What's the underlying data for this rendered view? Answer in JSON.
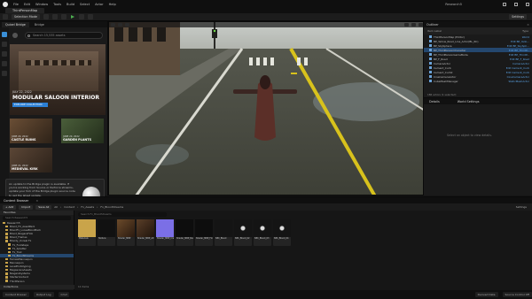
{
  "menubar": {
    "items": [
      "File",
      "Edit",
      "Window",
      "Tools",
      "Build",
      "Select",
      "Actor",
      "Help"
    ],
    "project": "Research5"
  },
  "tabs": {
    "active": "ThirdPersonMap"
  },
  "toolbar": {
    "mode": "Selection Mode",
    "settings": "Settings"
  },
  "bridge": {
    "tabs": [
      "Quixel Bridge",
      "Bridge"
    ],
    "search_placeholder": "Search 15,535 assets",
    "hero": {
      "date": "JULY 22, 2022",
      "title": "MODULAR SALOON INTERIOR",
      "button": "EXPLORE COLLECTION"
    },
    "cards": [
      {
        "date": "JUNE 20, 2022",
        "title": "CASTLE RUINS"
      },
      {
        "date": "JUNE 20, 2022",
        "title": "GARDEN PLANTS"
      },
      {
        "date": "JUNE 21, 2022",
        "title": "MEDIEVAL KIRK"
      }
    ],
    "notice": "An update to the Bridge plugin is available. If you're working from Source or Perforce streams, update your fork of the Bridge plugin source code to get the latest update.",
    "notice_link": "Update via Launcher"
  },
  "outliner": {
    "title": "Outliner",
    "col_label": "Item Label",
    "col_type": "Type",
    "rows": [
      {
        "label": "ThirdPersonMap (Editor)",
        "type": "World"
      },
      {
        "label": "BP_Yellow_Road_Line_Actor(BL_RC)",
        "type": "Edit BP_Yello..."
      },
      {
        "label": "BP_SkySphere",
        "type": "Edit BP_SkySph..."
      },
      {
        "label": "BP_ThirdPersonCharacter",
        "type": "Edit BP_ThirdP..."
      },
      {
        "label": "BP_ThirdPersonGameMode",
        "type": "Edit BP_ThirdP..."
      },
      {
        "label": "BP_F_Road",
        "type": "Edit BP_F_Road"
      },
      {
        "label": "CameraActor",
        "type": "CameraActor"
      },
      {
        "label": "Cement_Curb",
        "type": "Edit Cement_Curb"
      },
      {
        "label": "Cement_Curb2",
        "type": "Edit Cement_Curb"
      },
      {
        "label": "CineCameraActor",
        "type": "CineCameraActor"
      },
      {
        "label": "CubeMeshManager",
        "type": "StaticMeshActor"
      }
    ],
    "count": "186 actors (1 selected)"
  },
  "details": {
    "tabs": [
      "Details",
      "World Settings"
    ],
    "empty": "Select an object to view details."
  },
  "content_browser": {
    "tab": "Content Browser",
    "add": "+ Add",
    "import": "Import",
    "save_all": "Save All",
    "breadcrumb": [
      "All",
      "Content",
      "Fx_Assets",
      "Fx_BloodStreams"
    ],
    "settings": "Settings",
    "tree_header": "Favorites",
    "tree_search": "Search Research5",
    "tree": [
      "Research5",
      "Blood_FX_AssetPack",
      "BloodFx_LooseBloodPack",
      "Blood_NiagaraFlob",
      "Blood_Frames",
      "Bloody_Unreal Fx",
      "Fx_Footsteps",
      "Fx_Splatter",
      "Fx_Trail",
      "Fx_BloodStreams",
      "FemaleMannequin",
      "Mannequin",
      "LevelPrototyping",
      "MegascansAssets",
      "NiagaraSystems",
      "StarterContent",
      "ThirdPerson"
    ],
    "selected_folder": "Fx_BloodStreams",
    "collections": "Collections",
    "asset_search": "Search Fx_BloodStreams",
    "assets": [
      "Materials",
      "Texture",
      "Shader_MBP",
      "Shader_MBP_Alt",
      "Shader_MBP_Crack",
      "Shader_MBP_Normal",
      "Shader_MBP_Flow",
      "NPC_Blood",
      "NPC_Blood_02",
      "NPC_Blood_03",
      "NPC_Blood_04"
    ],
    "items": "11 items"
  },
  "status": {
    "content_drawer": "Content Drawer",
    "output_log": "Output Log",
    "cmd": "Cmd",
    "derived": "Derived Data",
    "source": "Source Control Off"
  },
  "colors": {
    "accent": "#3a8fd6",
    "folder": "#c9a44a",
    "selection": "#24476e"
  }
}
